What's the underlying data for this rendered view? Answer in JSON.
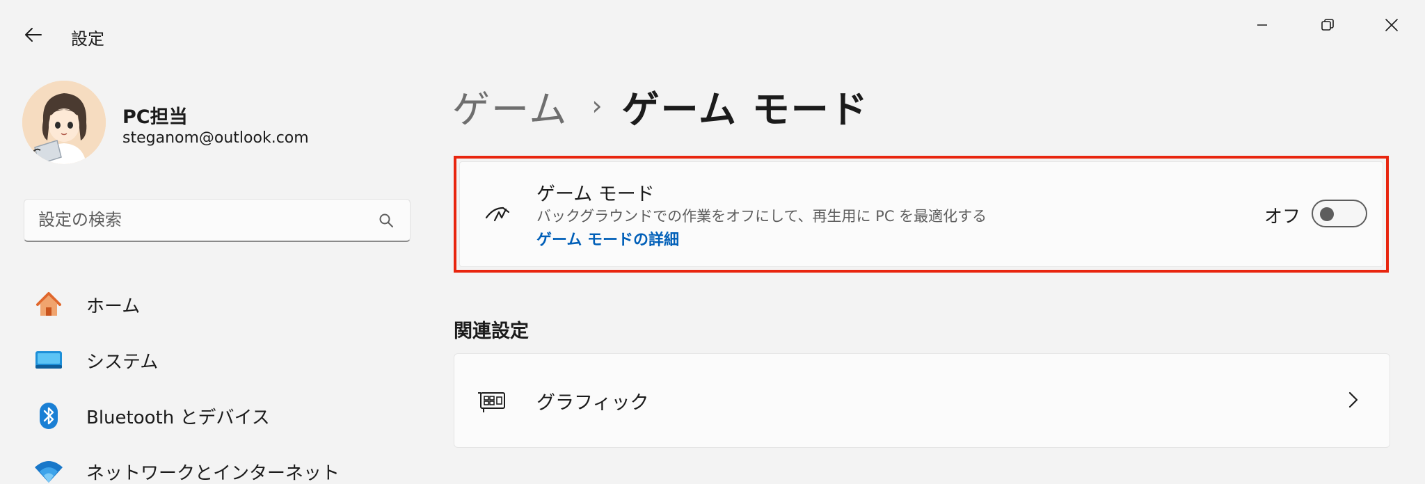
{
  "window": {
    "title": "設定"
  },
  "profile": {
    "name": "PC担当",
    "email": "steganom@outlook.com"
  },
  "search": {
    "placeholder": "設定の検索"
  },
  "nav": {
    "items": [
      {
        "label": "ホーム",
        "icon": "home-icon"
      },
      {
        "label": "システム",
        "icon": "system-icon"
      },
      {
        "label": "Bluetooth とデバイス",
        "icon": "bluetooth-icon"
      },
      {
        "label": "ネットワークとインターネット",
        "icon": "wifi-icon"
      }
    ]
  },
  "breadcrumb": {
    "parent": "ゲーム",
    "separator": "›",
    "current": "ゲーム モード"
  },
  "game_mode": {
    "title": "ゲーム モード",
    "description": "バックグラウンドでの作業をオフにして、再生用に PC を最適化する",
    "link": "ゲーム モードの詳細",
    "state_label": "オフ",
    "enabled": false
  },
  "related": {
    "heading": "関連設定",
    "items": [
      {
        "label": "グラフィック",
        "icon": "graphics-card-icon"
      }
    ]
  },
  "colors": {
    "accent": "#005fb8",
    "highlight_border": "#e8250e",
    "background": "#f3f3f3",
    "card": "#fbfbfb"
  }
}
